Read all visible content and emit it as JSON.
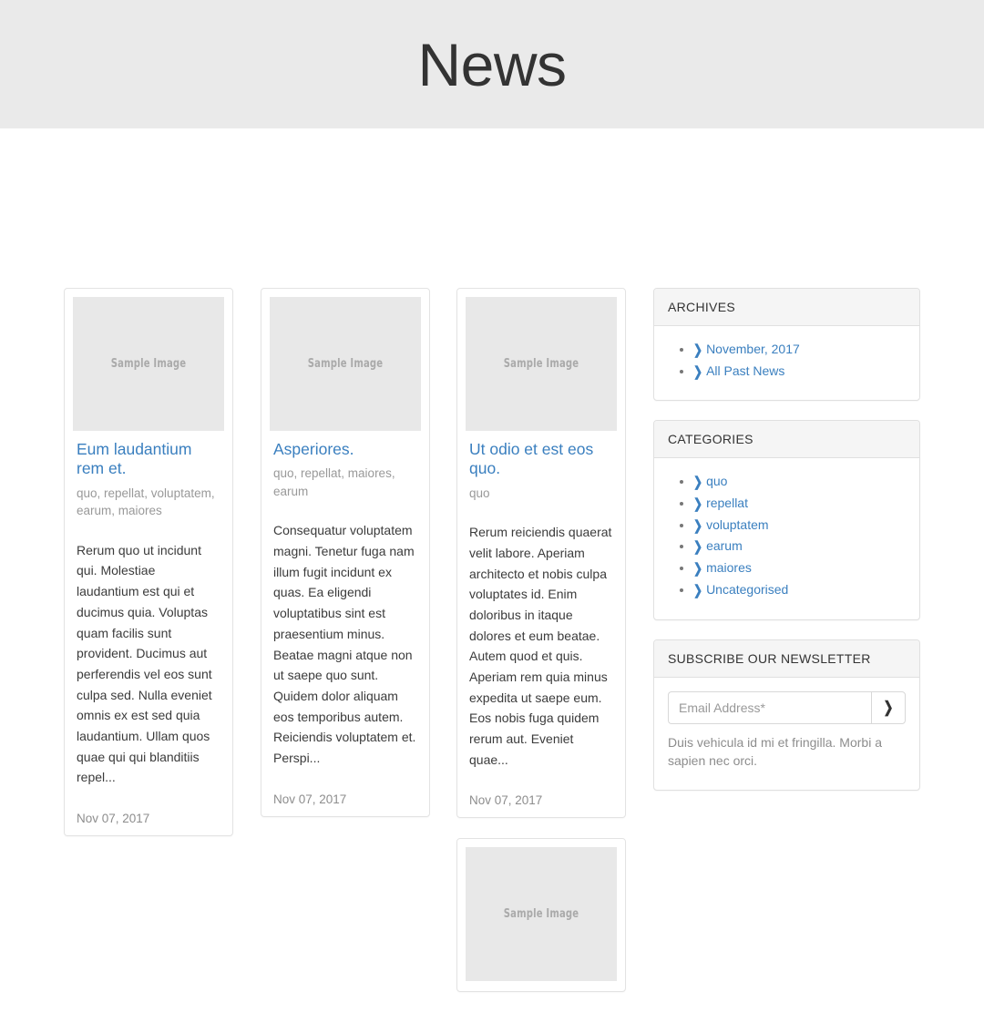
{
  "header": {
    "title": "News"
  },
  "theme": {
    "link_blue": "#3a7fbf",
    "band_gray": "#eaeaea",
    "panel_head_gray": "#f5f5f5",
    "thumb_gray": "#e8e8e8",
    "muted_text": "#8d8d8d"
  },
  "articles": [
    {
      "thumb_label": "Sample Image",
      "title": "Eum laudantium rem et.",
      "tags": "quo, repellat, voluptatem, earum, maiores",
      "excerpt": "Rerum quo ut incidunt qui. Molestiae laudantium est qui et ducimus quia. Voluptas quam facilis sunt provident. Ducimus aut perferendis vel eos sunt culpa sed. Nulla eveniet omnis ex est sed quia laudantium. Ullam quos quae qui qui blanditiis repel...",
      "date": "Nov 07, 2017",
      "column": 1
    },
    {
      "thumb_label": "Sample Image",
      "title": "Asperiores.",
      "tags": "quo, repellat, maiores, earum",
      "excerpt": "Consequatur voluptatem magni. Tenetur fuga nam illum fugit incidunt ex quas. Ea eligendi voluptatibus sint est praesentium minus. Beatae magni atque non ut saepe quo sunt. Quidem dolor aliquam eos temporibus autem. Reiciendis voluptatem et. Perspi...",
      "date": "Nov 07, 2017",
      "column": 2
    },
    {
      "thumb_label": "Sample Image",
      "title": "Ut odio et est eos quo.",
      "tags": "quo",
      "excerpt": "Rerum reiciendis quaerat velit labore. Aperiam architecto et nobis culpa voluptates id. Enim doloribus in itaque dolores et eum beatae. Autem quod et quis. Aperiam rem quia minus expedita ut saepe eum. Eos nobis fuga quidem rerum aut. Eveniet quae...",
      "date": "Nov 07, 2017",
      "column": 3
    },
    {
      "thumb_label": "Sample Image",
      "title": "",
      "tags": "",
      "excerpt": "",
      "date": "",
      "column": 3
    }
  ],
  "sidebar": {
    "archives": {
      "heading": "ARCHIVES",
      "items": [
        {
          "label": "November, 2017",
          "icon": "chevron-right-icon"
        },
        {
          "label": "All Past News",
          "icon": "chevron-right-icon"
        }
      ]
    },
    "categories": {
      "heading": "CATEGORIES",
      "items": [
        {
          "label": "quo",
          "icon": "chevron-right-icon"
        },
        {
          "label": "repellat",
          "icon": "chevron-right-icon"
        },
        {
          "label": "voluptatem",
          "icon": "chevron-right-icon"
        },
        {
          "label": "earum",
          "icon": "chevron-right-icon"
        },
        {
          "label": "maiores",
          "icon": "chevron-right-icon"
        },
        {
          "label": "Uncategorised",
          "icon": "chevron-right-icon"
        }
      ]
    },
    "newsletter": {
      "heading": "SUBSCRIBE OUR NEWSLETTER",
      "email_placeholder": "Email Address*",
      "email_value": "",
      "submit_icon": "chevron-right-icon",
      "note": "Duis vehicula id mi et fringilla. Morbi a sapien nec orci."
    }
  }
}
